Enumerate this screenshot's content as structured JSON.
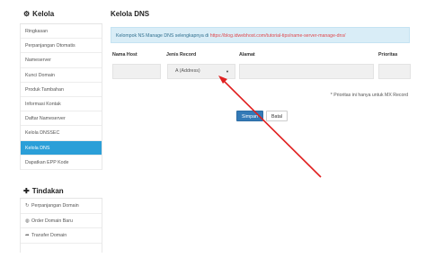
{
  "sidebar": {
    "title": "Kelola",
    "title_icon": "gear-icon",
    "items": [
      {
        "label": "Ringkasan"
      },
      {
        "label": "Perpanjangan Otomatis"
      },
      {
        "label": "Nameserver"
      },
      {
        "label": "Kunci Domain"
      },
      {
        "label": "Produk Tambahan"
      },
      {
        "label": "Informasi Kontak"
      },
      {
        "label": "Daftar Nameserver"
      },
      {
        "label": "Kelola DNSSEC"
      },
      {
        "label": "Kelola DNS",
        "active": true
      },
      {
        "label": "Dapatkan EPP Kode"
      }
    ]
  },
  "actions": {
    "title": "Tindakan",
    "items": [
      {
        "label": "Perpanjangan Domain",
        "icon": "refresh-icon"
      },
      {
        "label": "Order Domain Baru",
        "icon": "globe-icon"
      },
      {
        "label": "Transfer Domain",
        "icon": "share-icon"
      }
    ]
  },
  "main": {
    "title": "Kelola DNS",
    "info_text": "Kelompok NS Manage DNS selengkapnya di ",
    "info_link": "https://blog.idwebhost.com/tutorial-tips/name-server-manage-dns/",
    "columns": {
      "name": "Nama Host",
      "type": "Jenis Record",
      "address": "Alamat",
      "priority": "Prioritas"
    },
    "record_type_selected": "A (Address)",
    "note": "* Prioritas ini hanya untuk MX Record",
    "save_label": "Simpan",
    "cancel_label": "Batal"
  },
  "colors": {
    "active": "#2b9fd8",
    "primary": "#337ab7",
    "info_bg": "#d9edf7",
    "arrow": "#e02020"
  }
}
